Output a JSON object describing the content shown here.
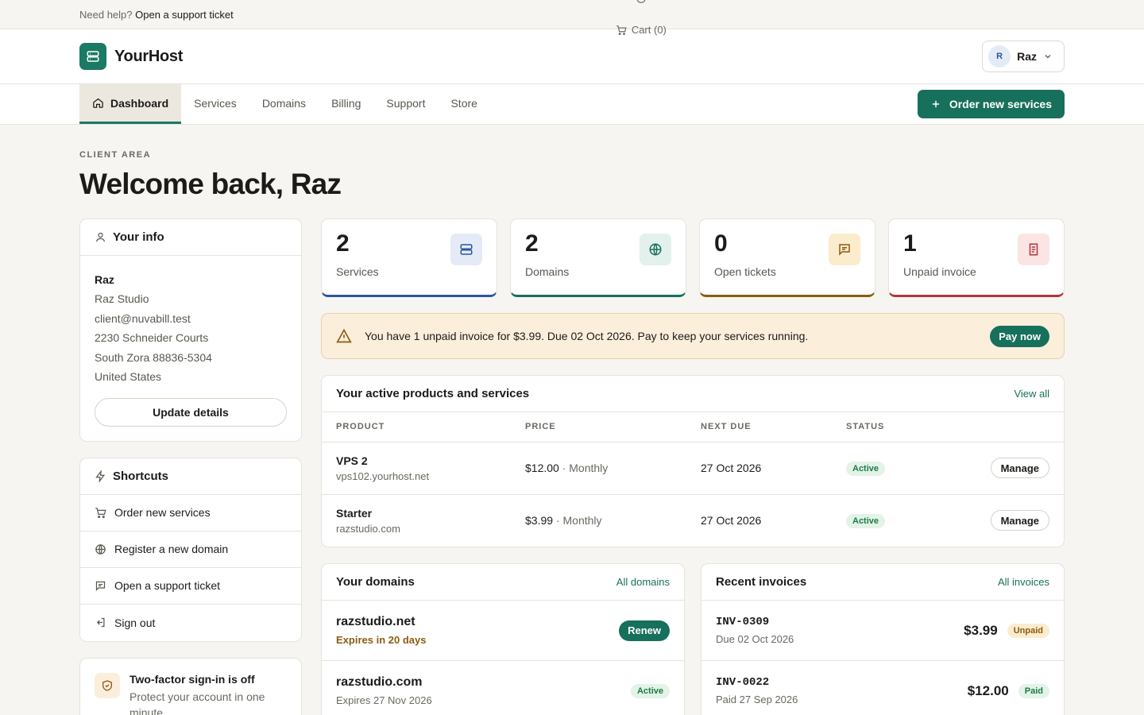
{
  "topbar": {
    "help_prefix": "Need help?",
    "help_link": "Open a support ticket",
    "cart_label": "Cart (0)"
  },
  "header": {
    "brand": "YourHost",
    "user_initial": "R",
    "user_name": "Raz"
  },
  "nav": {
    "tabs": [
      {
        "label": "Dashboard",
        "active": true
      },
      {
        "label": "Services"
      },
      {
        "label": "Domains"
      },
      {
        "label": "Billing"
      },
      {
        "label": "Support"
      },
      {
        "label": "Store"
      }
    ],
    "order_button": "Order new services"
  },
  "page": {
    "eyebrow": "CLIENT AREA",
    "title": "Welcome back, Raz"
  },
  "your_info": {
    "title": "Your info",
    "name": "Raz",
    "lines": [
      "Raz Studio",
      "client@nuvabill.test",
      "2230 Schneider Courts",
      "South Zora 88836-5304",
      "United States"
    ],
    "update_button": "Update details"
  },
  "shortcuts": {
    "title": "Shortcuts",
    "items": [
      {
        "label": "Order new services",
        "icon": "cart-icon"
      },
      {
        "label": "Register a new domain",
        "icon": "globe-icon"
      },
      {
        "label": "Open a support ticket",
        "icon": "chat-icon"
      },
      {
        "label": "Sign out",
        "icon": "sign-out-icon"
      }
    ]
  },
  "twofa": {
    "title": "Two-factor sign-in is off",
    "subtitle": "Protect your account in one minute"
  },
  "stats": [
    {
      "value": "2",
      "label": "Services",
      "color": "#2d55a0",
      "bg": "#e4ebf6",
      "icon": "server-icon"
    },
    {
      "value": "2",
      "label": "Domains",
      "color": "#17705b",
      "bg": "#e3f1ec",
      "icon": "globe-icon"
    },
    {
      "value": "0",
      "label": "Open tickets",
      "color": "#8a5c12",
      "bg": "#fbeccd",
      "icon": "chat-icon"
    },
    {
      "value": "1",
      "label": "Unpaid invoice",
      "color": "#b3333a",
      "bg": "#fbe4e4",
      "icon": "invoice-icon"
    }
  ],
  "alert": {
    "message": "You have 1 unpaid invoice for $3.99. Due 02 Oct 2026. Pay to keep your services running.",
    "button": "Pay now"
  },
  "services": {
    "title": "Your active products and services",
    "view_all": "View all",
    "columns": [
      "PRODUCT",
      "PRICE",
      "NEXT DUE",
      "STATUS"
    ],
    "rows": [
      {
        "name": "VPS 2",
        "host": "vps102.yourhost.net",
        "price": "$12.00",
        "cycle": "· Monthly",
        "due": "27 Oct 2026",
        "status": "Active",
        "action": "Manage"
      },
      {
        "name": "Starter",
        "host": "razstudio.com",
        "price": "$3.99",
        "cycle": "· Monthly",
        "due": "27 Oct 2026",
        "status": "Active",
        "action": "Manage"
      }
    ]
  },
  "domains": {
    "title": "Your domains",
    "link": "All domains",
    "rows": [
      {
        "name": "razstudio.net",
        "sub": "Expires in 20 days",
        "action": "Renew"
      },
      {
        "name": "razstudio.com",
        "sub": "Expires 27 Nov 2026",
        "status": "Active"
      }
    ]
  },
  "invoices": {
    "title": "Recent invoices",
    "link": "All invoices",
    "rows": [
      {
        "id": "INV-0309",
        "sub": "Due 02 Oct 2026",
        "amount": "$3.99",
        "status": "Unpaid"
      },
      {
        "id": "INV-0022",
        "sub": "Paid 27 Sep 2026",
        "amount": "$12.00",
        "status": "Paid"
      }
    ]
  }
}
